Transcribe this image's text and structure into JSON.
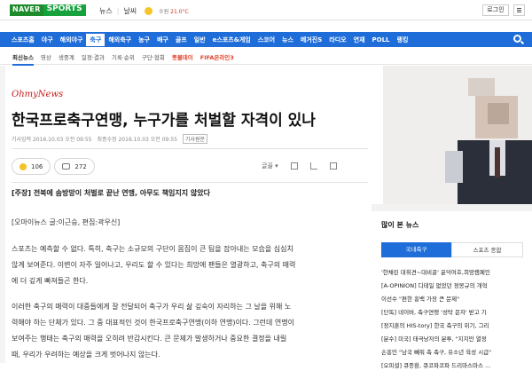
{
  "topbar": {
    "logo_naver": "NAVER",
    "logo_sports": "SPORTS",
    "links": [
      "뉴스",
      "날씨"
    ],
    "weather_place": "수원",
    "weather_temp": "21.0°C",
    "login_label": "로그인"
  },
  "nav": {
    "items": [
      "스포츠홈",
      "야구",
      "해외야구",
      "축구",
      "해외축구",
      "농구",
      "배구",
      "골프",
      "일반",
      "e스포츠&게임",
      "스코어",
      "뉴스",
      "메거진S",
      "라디오",
      "연재",
      "POLL",
      "랭킹"
    ],
    "active_index": 3
  },
  "subnav": {
    "items": [
      "최신뉴스",
      "영상",
      "생중계",
      "일정·결과",
      "기록·순위",
      "구단·협회",
      "풋볼데이",
      "FIFA온라인3"
    ]
  },
  "article": {
    "source": "OhmyNews",
    "title": "한국프로축구연맹, 누구가를 처벌할 자격이 있나",
    "published": "기사입력 2016.10.03 오전 09:55",
    "updated": "최종수정 2016.10.03 오전 09:55",
    "original_label": "기사원문",
    "like_count": "106",
    "comment_count": "272",
    "font_label": "글꼴",
    "summary": "[주장] 전북에 솜방망이 처벌로 끝난 연맹, 아무도 책임지지 않았다",
    "byline": "[오마이뉴스 글:이근승, 편집:곽우신]",
    "paragraphs": [
      "스포츠는 예측할 수 없다. 특히, 축구는 소규모의 구단이 몸집이 큰 팀을 잡아내는 모습을 심심치",
      "않게 보여준다. 이변이 자주 일어나고, 우리도 할 수 있다는 희망에 팬들은 열광하고, 축구의 매력",
      "에 더 깊게 빠져들곤 한다.",
      "이러한 축구의 매력이 대중들에게 잘 전달되어 축구가 우리 삶 깊숙이 자리하는 그 날을 위해 노",
      "력해야 하는 단체가 있다. 그 중 대표적인 것이 한국프로축구연맹(이하 연맹)이다. 그런데 연맹이",
      "보여주는 행태는 축구의 매력을 오히려 반감시킨다. 큰 문제가 발생하거나 중요한 결정을 내릴",
      "때, 우리가 우려하는 예상을 크게 벗어나지 않는다."
    ]
  },
  "sidebar": {
    "popular_title": "많이 본 뉴스",
    "tabs": [
      "국내축구",
      "스포츠 종합"
    ],
    "items": [
      "'한채린 대휘견~대비골' 윤덕여호,희망캠페인",
      "[A-OPINION] 디테일 없었던 정몽규의 개혁",
      "이선수 \"편한 흥백 가장 큰 문제\"",
      "[단독] 네이버, 축구연맹 '성탁 문자' 받고 기",
      "[정지훈의 HIS-tory] 한국 축구의 위기, 그리",
      "[분수] 미국] 태극낭자의 분투, \"지지만 열정",
      "손흥민 \"남국 빼줘 축 축구, 유소년 육성 시급\"",
      "[오피셜] 큐종환, 큐코파코파 드리마스마스 ..."
    ]
  },
  "colors": {
    "brand_green": "#17a23d",
    "nav_blue": "#1f6dd8",
    "source_red": "#c51818"
  }
}
